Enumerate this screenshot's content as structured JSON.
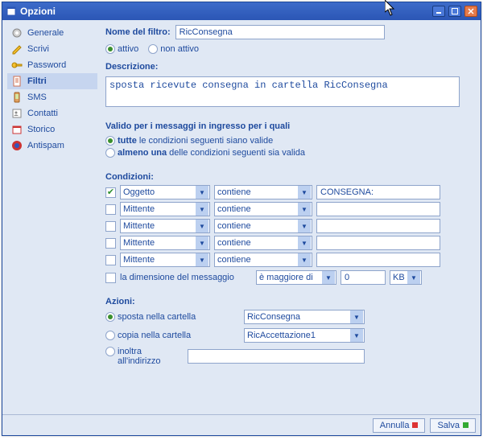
{
  "window": {
    "title": "Opzioni"
  },
  "sidebar": {
    "items": [
      {
        "label": "Generale"
      },
      {
        "label": "Scrivi"
      },
      {
        "label": "Password"
      },
      {
        "label": "Filtri"
      },
      {
        "label": "SMS"
      },
      {
        "label": "Contatti"
      },
      {
        "label": "Storico"
      },
      {
        "label": "Antispam"
      }
    ],
    "selected_index": 3
  },
  "form": {
    "name_label": "Nome del filtro:",
    "name_value": "RicConsegna",
    "status": {
      "active": "attivo",
      "inactive": "non attivo",
      "selected": "attivo"
    },
    "desc_label": "Descrizione:",
    "desc_value": "sposta ricevute consegna in cartella RicConsegna",
    "valid_label": "Valido per i messaggi in ingresso per i quali",
    "valid_all_bold": "tutte",
    "valid_all_rest": " le condizioni seguenti siano valide",
    "valid_any_bold": "almeno una",
    "valid_any_rest": " delle condizioni seguenti sia valida",
    "valid_selected": "tutte",
    "cond_label": "Condizioni:",
    "conditions": [
      {
        "enabled": true,
        "field": "Oggetto",
        "op": "contiene",
        "value": "CONSEGNA:"
      },
      {
        "enabled": false,
        "field": "Mittente",
        "op": "contiene",
        "value": ""
      },
      {
        "enabled": false,
        "field": "Mittente",
        "op": "contiene",
        "value": ""
      },
      {
        "enabled": false,
        "field": "Mittente",
        "op": "contiene",
        "value": ""
      },
      {
        "enabled": false,
        "field": "Mittente",
        "op": "contiene",
        "value": ""
      }
    ],
    "size_cond": {
      "enabled": false,
      "label": "la dimensione del messaggio",
      "op": "è maggiore di",
      "value": "0",
      "unit": "KB"
    },
    "actions_label": "Azioni:",
    "action_move": {
      "label": "sposta nella cartella",
      "folder": "RicConsegna"
    },
    "action_copy": {
      "label": "copia nella cartella",
      "folder": "RicAccettazione1"
    },
    "action_fwd": {
      "label": "inoltra all'indirizzo",
      "value": ""
    },
    "action_selected": "sposta"
  },
  "footer": {
    "cancel": "Annulla",
    "save": "Salva"
  }
}
